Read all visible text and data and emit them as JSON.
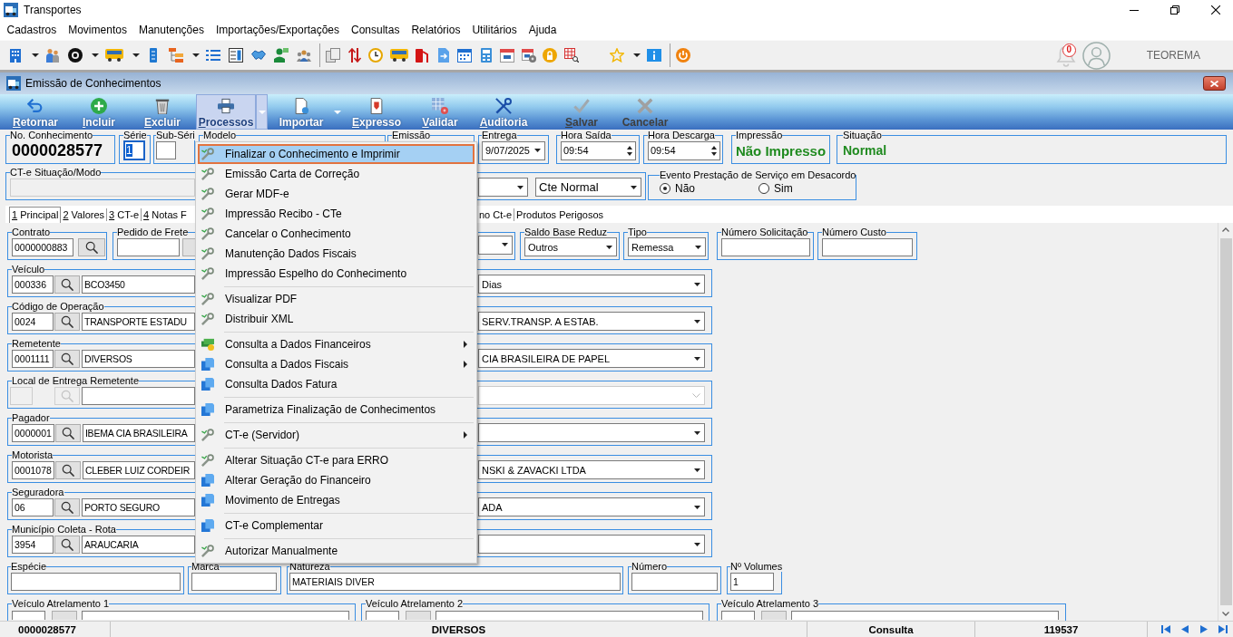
{
  "window": {
    "title": "Transportes"
  },
  "menu_bar": [
    "Cadastros",
    "Movimentos",
    "Manutenções",
    "Importações/Exportações",
    "Consultas",
    "Relatórios",
    "Utilitários",
    "Ajuda"
  ],
  "toolbar": {
    "notification_count": "0",
    "user_name": "TEOREMA"
  },
  "document_window": {
    "title": "Emissão de Conhecimentos"
  },
  "ribbon": [
    {
      "label": "Retornar",
      "underline_first": true,
      "selected": false,
      "disabled": false,
      "dropdown": false
    },
    {
      "label": "Incluir",
      "underline_first": true,
      "selected": false,
      "disabled": false,
      "dropdown": false
    },
    {
      "label": "Excluir",
      "underline_first": true,
      "selected": false,
      "disabled": false,
      "dropdown": false
    },
    {
      "label": "Processos",
      "underline_first": true,
      "selected": true,
      "disabled": false,
      "dropdown": true
    },
    {
      "label": "Importar",
      "underline_first": false,
      "selected": false,
      "disabled": false,
      "dropdown": true
    },
    {
      "label": "Expresso",
      "underline_first": true,
      "selected": false,
      "disabled": false,
      "dropdown": false
    },
    {
      "label": "Validar",
      "underline_first": true,
      "selected": false,
      "disabled": false,
      "dropdown": false
    },
    {
      "label": "Auditoria",
      "underline_first": true,
      "selected": false,
      "disabled": false,
      "dropdown": false
    },
    {
      "label": "Salvar",
      "underline_first": true,
      "selected": false,
      "disabled": true,
      "dropdown": false
    },
    {
      "label": "Cancelar",
      "underline_first": false,
      "selected": false,
      "disabled": true,
      "dropdown": false
    }
  ],
  "process_menu": {
    "sections": [
      {
        "items": [
          {
            "label": "Finalizar o Conhecimento e Imprimir",
            "kind": "process",
            "selected": true,
            "submenu": false
          },
          {
            "label": "Emissão Carta de Correção",
            "kind": "process",
            "selected": false,
            "submenu": false
          },
          {
            "label": "Gerar MDF-e",
            "kind": "process",
            "selected": false,
            "submenu": false
          },
          {
            "label": "Impressão Recibo - CTe",
            "kind": "process",
            "selected": false,
            "submenu": false
          },
          {
            "label": "Cancelar o Conhecimento",
            "kind": "process",
            "selected": false,
            "submenu": false
          },
          {
            "label": "Manutenção Dados Fiscais",
            "kind": "process",
            "selected": false,
            "submenu": false
          },
          {
            "label": "Impressão Espelho do Conhecimento",
            "kind": "process",
            "selected": false,
            "submenu": false
          }
        ]
      },
      {
        "items": [
          {
            "label": "Visualizar PDF",
            "kind": "process",
            "selected": false,
            "submenu": false
          },
          {
            "label": "Distribuir XML",
            "kind": "process",
            "selected": false,
            "submenu": false
          }
        ]
      },
      {
        "items": [
          {
            "label": "Consulta a Dados Financeiros",
            "kind": "finance",
            "selected": false,
            "submenu": true
          },
          {
            "label": "Consulta a Dados Fiscais",
            "kind": "query",
            "selected": false,
            "submenu": true
          },
          {
            "label": "Consulta Dados Fatura",
            "kind": "query",
            "selected": false,
            "submenu": false
          }
        ]
      },
      {
        "items": [
          {
            "label": "Parametriza Finalização de Conhecimentos",
            "kind": "query",
            "selected": false,
            "submenu": false
          }
        ]
      },
      {
        "items": [
          {
            "label": "CT-e (Servidor)",
            "kind": "process",
            "selected": false,
            "submenu": true
          }
        ]
      },
      {
        "items": [
          {
            "label": "Alterar Situação CT-e para ERRO",
            "kind": "process",
            "selected": false,
            "submenu": false
          },
          {
            "label": "Alterar Geração do Financeiro",
            "kind": "query",
            "selected": false,
            "submenu": false
          },
          {
            "label": "Movimento de Entregas",
            "kind": "query",
            "selected": false,
            "submenu": false
          }
        ]
      },
      {
        "items": [
          {
            "label": "CT-e Complementar",
            "kind": "query",
            "selected": false,
            "submenu": false
          }
        ]
      },
      {
        "items": [
          {
            "label": "Autorizar Manualmente",
            "kind": "process",
            "selected": false,
            "submenu": false
          }
        ]
      }
    ]
  },
  "header": {
    "numero": {
      "label": "No. Conhecimento",
      "value": "0000028577"
    },
    "serie": {
      "label": "Série",
      "value": "1",
      "focused": true
    },
    "sub_serie": {
      "label": "Sub-Séri"
    },
    "modelo": {
      "label": "Modelo"
    },
    "emissao": {
      "label": "Emissão"
    },
    "entrega": {
      "label": "Entrega",
      "value": "9/07/2025"
    },
    "hora_saida": {
      "label": "Hora Saída",
      "value": "09:54"
    },
    "hora_descarga": {
      "label": "Hora Descarga",
      "value": "09:54"
    },
    "impressao": {
      "label": "Impressão",
      "value": "Não Impresso"
    },
    "situacao": {
      "label": "Situação",
      "value": "Normal"
    }
  },
  "mode_group": {
    "label": "CT-e Situação/Modo",
    "mode": "Cte Normal"
  },
  "evento": {
    "label": "Evento Prestação de Serviço em Desacordo",
    "options": [
      {
        "label": "Não",
        "selected": true
      },
      {
        "label": "Sim",
        "selected": false
      }
    ]
  },
  "tabs": [
    {
      "label": "1 Principal",
      "underline_first": true,
      "selected": true
    },
    {
      "label": "2 Valores",
      "underline_first": true,
      "selected": false
    },
    {
      "label": "3 CT-e",
      "underline_first": true,
      "selected": false
    },
    {
      "label": "4 Notas F",
      "underline_first": true,
      "selected": false
    },
    {
      "label": "no Ct-e",
      "underline_first": false,
      "selected": false
    },
    {
      "label": "Produtos Perigosos",
      "underline_first": false,
      "selected": false
    }
  ],
  "principal": {
    "contrato": {
      "label": "Contrato",
      "value": "0000000883"
    },
    "pedido_frete": {
      "label": "Pedido de Frete"
    },
    "saldo_base_reduz": {
      "label": "Saldo Base Reduz",
      "value": "Outros"
    },
    "tipo": {
      "label": "Tipo",
      "value": "Remessa"
    },
    "numero_solicitacao": {
      "label": "Número Solicitação"
    },
    "numero_custo": {
      "label": "Número Custo"
    },
    "parties": [
      {
        "label": "Veículo",
        "code": "000336",
        "name": "BCO3450",
        "option": "Dias",
        "disabled": false
      },
      {
        "label": "Código de Operação",
        "code": "0024",
        "name": "TRANSPORTE ESTADU",
        "option": "SERV.TRANSP. A ESTAB.",
        "disabled": false
      },
      {
        "label": "Remetente",
        "code": "0001111",
        "name": "DIVERSOS",
        "option": "CIA BRASILEIRA DE PAPEL",
        "disabled": false
      },
      {
        "label": "Local de Entrega Remetente",
        "disabled": true
      },
      {
        "label": "Pagador",
        "code": "0000001",
        "name": "IBEMA CIA BRASILEIRA",
        "disabled": false
      },
      {
        "label": "Motorista",
        "code": "0001078",
        "name": "CLEBER LUIZ CORDEIR",
        "option": "NSKI & ZAVACKI LTDA",
        "disabled": false
      },
      {
        "label": "Seguradora",
        "code": "06",
        "name": "PORTO SEGURO",
        "option": "ADA",
        "disabled": false
      },
      {
        "label": "Município Coleta - Rota",
        "code": "3954",
        "name": "ARAUCARIA",
        "disabled": false
      }
    ],
    "especie": {
      "label": "Espécie"
    },
    "marca": {
      "label": "Marca"
    },
    "natureza": {
      "label": "Natureza",
      "value": "MATERIAIS DIVER"
    },
    "numero": {
      "label": "Número"
    },
    "volumes": {
      "label": "Nº Volumes",
      "value": "1"
    },
    "atrelamentos": [
      {
        "label": "Veículo Atrelamento 1"
      },
      {
        "label": "Veículo Atrelamento 2"
      },
      {
        "label": "Veículo Atrelamento 3"
      }
    ]
  },
  "status_bar": [
    "0000028577",
    "DIVERSOS",
    "Consulta",
    "119537"
  ]
}
